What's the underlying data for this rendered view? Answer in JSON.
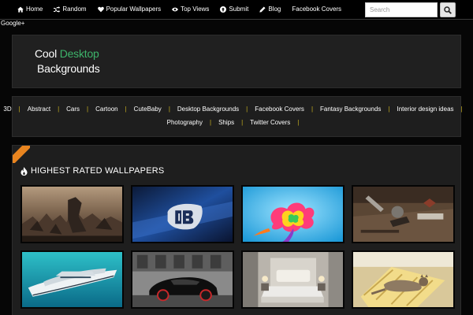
{
  "nav": {
    "items": [
      {
        "label": "Home",
        "icon": "home-icon"
      },
      {
        "label": "Random",
        "icon": "shuffle-icon"
      },
      {
        "label": "Popular Wallpapers",
        "icon": "heart-icon"
      },
      {
        "label": "Top Views",
        "icon": "eye-icon"
      },
      {
        "label": "Submit",
        "icon": "upload-icon"
      },
      {
        "label": "Blog",
        "icon": "pencil-icon"
      },
      {
        "label": "Facebook Covers",
        "icon": ""
      }
    ],
    "search_placeholder": "Search",
    "search_button_icon": "search-icon"
  },
  "gplus_label": "Google+",
  "logo": {
    "line1_a": "Cool ",
    "line1_b": "Desktop",
    "line2": "Backgrounds",
    "accent_color": "#3db36a"
  },
  "categories": {
    "row1": [
      "3D",
      "Abstract",
      "Cars",
      "Cartoon",
      "CuteBaby",
      "Desktop Backgrounds",
      "Facebook Covers",
      "Fantasy Backgrounds",
      "Interior design ideas"
    ],
    "row2": [
      "Photography",
      "Ships",
      "Twitter Covers"
    ],
    "separator": "|",
    "separator_color": "#c8b020"
  },
  "section": {
    "title": "HIGHEST RATED WALLPAPERS",
    "title_icon": "fire-icon",
    "ribbon_color": "#e8841f"
  },
  "thumbnails": [
    {
      "name": "fantasy-warriors"
    },
    {
      "name": "bugatti-logo"
    },
    {
      "name": "colorful-splash"
    },
    {
      "name": "workshop-desk"
    },
    {
      "name": "yacht"
    },
    {
      "name": "black-sports-car"
    },
    {
      "name": "bedroom-interior"
    },
    {
      "name": "cat-on-chair"
    }
  ]
}
